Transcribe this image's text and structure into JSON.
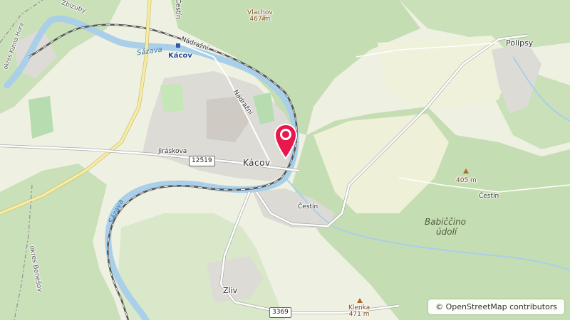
{
  "map": {
    "labels": {
      "kacov_town": "Kácov",
      "kacov_station": "Kácov",
      "nadrazni_1": "Nádražní",
      "nadrazni_2": "Nádražní",
      "jirsikova": "Jiráskova",
      "cestin_1": "Čestín",
      "cestin_2": "Čestín",
      "cestin_3": "Čestín",
      "polipsy": "Polipsy",
      "zliv": "Zliv",
      "babiccino_line1": "Babiččino",
      "babiccino_line2": "údolí",
      "sazava_1": "Sázava",
      "sazava_2": "Sázava",
      "vlachov_name": "Vlachov",
      "vlachov_elev": "467 m",
      "peak_405": "405 m",
      "klenka_name": "Klenka",
      "klenka_elev": "471 m",
      "okres_benesov": "okres Benešov",
      "zbizuby": "Zbizuby",
      "okres_kutna": "okres Kutná Hora"
    },
    "road_shields": {
      "r12519": "12519",
      "r3369": "3369"
    },
    "marker": {
      "icon": "map-pin-icon",
      "color": "#e8174c"
    },
    "colors": {
      "forest": "#c8e0b8",
      "meadow": "#eff0d8",
      "river": "#a8cde8",
      "urban": "#dcdad6",
      "road_major": "#f5eaa0"
    }
  },
  "attribution": {
    "copyright_symbol": "©",
    "text": "OpenStreetMap contributors"
  }
}
